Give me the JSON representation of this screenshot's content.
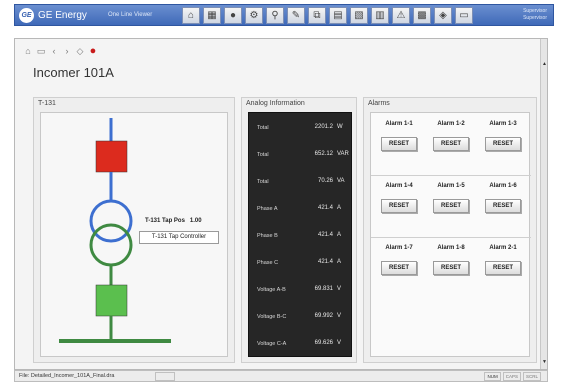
{
  "app": {
    "logo_text": "GE",
    "title": "GE Energy",
    "subtitle": "One Line Viewer",
    "user_line1": "Supervisor",
    "user_line2": "Supervisor"
  },
  "toolbar_icons": [
    "home-icon",
    "grid-icon",
    "circle-icon",
    "network-icon",
    "zoom-icon",
    "pencil-icon",
    "tabs-icon",
    "chart-icon",
    "report-icon",
    "table-icon",
    "alarm-icon",
    "stack-icon",
    "erase-icon",
    "monitor-icon"
  ],
  "toolbar_glyphs": [
    "⌂",
    "▦",
    "●",
    "⚙",
    "⚲",
    "✎",
    "⧉",
    "▤",
    "▧",
    "▥",
    "⚠",
    "▩",
    "◈",
    "▭"
  ],
  "nav": {
    "glyphs": [
      "⌂",
      "▭",
      "‹",
      "›",
      "◇",
      "●"
    ]
  },
  "page": {
    "title": "Incomer 101A"
  },
  "diagram": {
    "panel_label": "T-131",
    "tap_pos_label": "T-131 Tap Pos",
    "tap_pos_value": "1.00",
    "tap_controller_label": "T-131 Tap Controller",
    "colors": {
      "breaker_open": "#dc2b1e",
      "breaker_closed": "#5bbf4e",
      "primary_winding": "#3d6fd0",
      "secondary_winding": "#3f8a42"
    }
  },
  "analog": {
    "panel_label": "Analog Information",
    "rows": [
      {
        "name": "Total",
        "value": "2201.2",
        "unit": "W"
      },
      {
        "name": "Total",
        "value": "652.12",
        "unit": "VAR"
      },
      {
        "name": "Total",
        "value": "70.26",
        "unit": "VA"
      },
      {
        "name": "Phase A",
        "value": "421.4",
        "unit": "A"
      },
      {
        "name": "Phase B",
        "value": "421.4",
        "unit": "A"
      },
      {
        "name": "Phase C",
        "value": "421.4",
        "unit": "A"
      },
      {
        "name": "Voltage A-B",
        "value": "69.831",
        "unit": "V"
      },
      {
        "name": "Voltage B-C",
        "value": "69.992",
        "unit": "V"
      },
      {
        "name": "Voltage C-A",
        "value": "69.626",
        "unit": "V"
      }
    ]
  },
  "alarms": {
    "panel_label": "Alarms",
    "reset_label": "RESET",
    "groups": [
      [
        "Alarm 1-1",
        "Alarm 1-2",
        "Alarm 1-3"
      ],
      [
        "Alarm 1-4",
        "Alarm 1-5",
        "Alarm 1-6"
      ],
      [
        "Alarm 1-7",
        "Alarm 1-8",
        "Alarm 2-1"
      ]
    ]
  },
  "status": {
    "file_label": "File: Detailed_Incomer_101A_Final.dra",
    "indicators": [
      "NUM",
      "CAPS",
      "SCRL"
    ]
  }
}
